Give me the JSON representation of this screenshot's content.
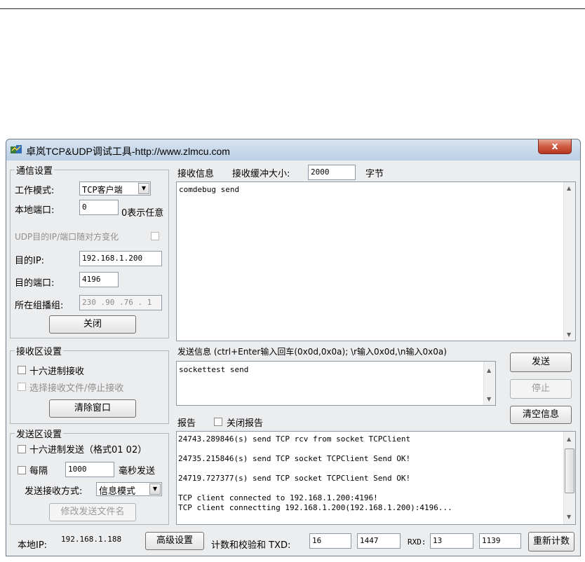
{
  "window": {
    "title": "卓岚TCP&UDP调试工具-http://www.zlmcu.com",
    "close_label": "x"
  },
  "comm": {
    "legend": "通信设置",
    "mode_label": "工作模式:",
    "mode_value": "TCP客户端",
    "local_port_label": "本地端口:",
    "local_port_value": "0",
    "local_port_hint": "0表示任意",
    "udp_follow_label": "UDP目的IP/端口随对方变化",
    "dest_ip_label": "目的IP:",
    "dest_ip_value": "192.168.1.200",
    "dest_port_label": "目的端口:",
    "dest_port_value": "4196",
    "group_label": "所在组播组:",
    "group_value": "230 .90 .76 . 1",
    "close_button": "关闭"
  },
  "recv_settings": {
    "legend": "接收区设置",
    "hex_label": "十六进制接收",
    "file_label": "选择接收文件/停止接收",
    "clear_button": "清除窗口"
  },
  "send_settings": {
    "legend": "发送区设置",
    "hex_label": "十六进制发送（格式01 02）",
    "interval_label": "每隔",
    "interval_value": "1000",
    "interval_unit": "毫秒发送",
    "mode_label": "发送接收方式:",
    "mode_value": "信息模式",
    "file_button": "修改发送文件名"
  },
  "receive": {
    "label": "接收信息",
    "buffer_label": "接收缓冲大小:",
    "buffer_value": "2000",
    "buffer_unit": "字节",
    "content": "comdebug send"
  },
  "send": {
    "label": "发送信息 (ctrl+Enter输入回车(0x0d,0x0a); \\r输入0x0d,\\n输入0x0a)",
    "content": "sockettest send",
    "send_button": "发送",
    "stop_button": "停止",
    "clear_button": "清空信息"
  },
  "report": {
    "label": "报告",
    "close_report_label": "关闭报告",
    "lines": [
      "24743.289846(s) send TCP rcv from socket TCPClient",
      "",
      "24735.215846(s) send TCP socket TCPClient Send OK!",
      "",
      "24719.727377(s) send TCP socket TCPClient Send OK!",
      "",
      "TCP client connected to 192.168.1.200:4196!",
      "TCP client connectting 192.168.1.200(192.168.1.200):4196..."
    ]
  },
  "status": {
    "local_ip_label": "本地IP:",
    "local_ip_value": "192.168.1.188",
    "advanced_button": "高级设置",
    "checksum_label": "计数和校验和 TXD:",
    "txd_count": "16",
    "txd_sum": "1447",
    "rxd_label": "RXD:",
    "rxd_count": "13",
    "rxd_sum": "1139",
    "reset_button": "重新计数"
  },
  "colors": {
    "title_bar": "#c7d8ea",
    "window_bg": "#ecedef",
    "close_button": "#cf5b42"
  }
}
